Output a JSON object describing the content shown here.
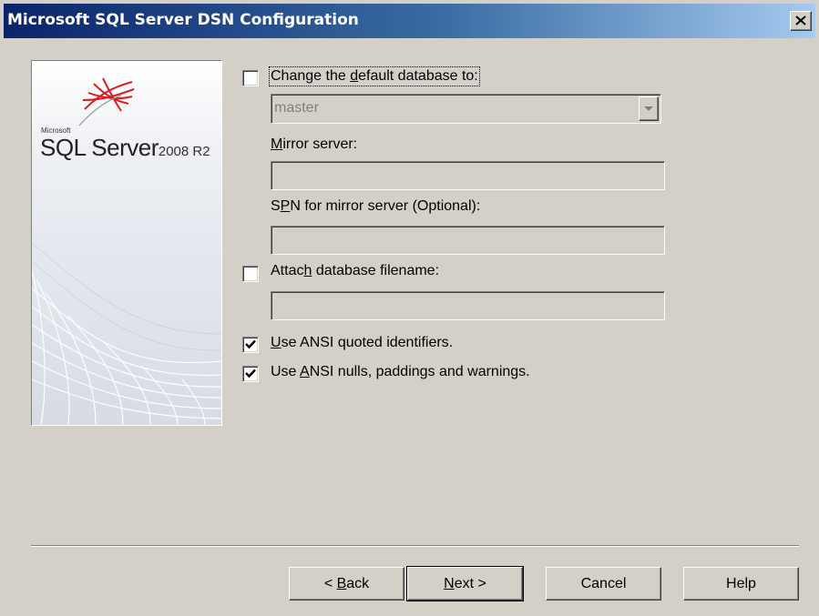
{
  "window": {
    "title": "Microsoft SQL Server DSN Configuration"
  },
  "logo": {
    "small": "Microsoft",
    "product": "SQL Server",
    "version": "2008 R2"
  },
  "options": {
    "change_default_db": {
      "pre": "Change the ",
      "mnemonic": "d",
      "post": "efault database to:",
      "checked": false
    },
    "database_select": {
      "value": "master",
      "disabled": true
    },
    "mirror_server": {
      "mnemonic": "M",
      "post": "irror server:",
      "value": ""
    },
    "spn": {
      "pre": "S",
      "mnemonic": "P",
      "post": "N for mirror server (Optional):",
      "value": ""
    },
    "attach_db": {
      "pre": "Attac",
      "mnemonic": "h",
      "post": " database filename:",
      "checked": false,
      "value": ""
    },
    "ansi_quoted": {
      "mnemonic": "U",
      "post": "se ANSI quoted identifiers.",
      "checked": true
    },
    "ansi_nulls": {
      "pre": "Use ",
      "mnemonic": "A",
      "post": "NSI nulls, paddings and warnings.",
      "checked": true
    }
  },
  "buttons": {
    "back": {
      "pre": "< ",
      "mnemonic": "B",
      "post": "ack"
    },
    "next": {
      "mnemonic": "N",
      "post": "ext >"
    },
    "cancel": "Cancel",
    "help": "Help"
  }
}
